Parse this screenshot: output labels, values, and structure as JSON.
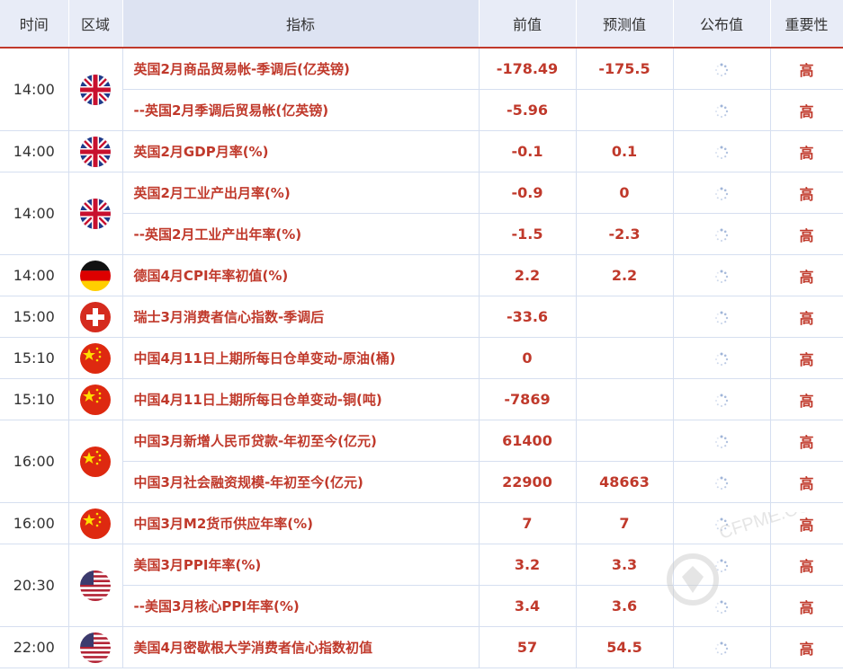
{
  "headers": {
    "time": "时间",
    "region": "区域",
    "indicator": "指标",
    "prev": "前值",
    "forecast": "预测值",
    "actual": "公布值",
    "importance": "重要性"
  },
  "groups": [
    {
      "time": "14:00",
      "flag": "uk",
      "rows": [
        {
          "name": "英国2月商品贸易帐-季调后(亿英镑)",
          "prev": "-178.49",
          "forecast": "-175.5",
          "importance": "高"
        },
        {
          "name": "--英国2月季调后贸易帐(亿英镑)",
          "prev": "-5.96",
          "forecast": "",
          "importance": "高"
        }
      ]
    },
    {
      "time": "14:00",
      "flag": "uk",
      "rows": [
        {
          "name": "英国2月GDP月率(%)",
          "prev": "-0.1",
          "forecast": "0.1",
          "importance": "高"
        }
      ]
    },
    {
      "time": "14:00",
      "flag": "uk",
      "rows": [
        {
          "name": "英国2月工业产出月率(%)",
          "prev": "-0.9",
          "forecast": "0",
          "importance": "高"
        },
        {
          "name": "--英国2月工业产出年率(%)",
          "prev": "-1.5",
          "forecast": "-2.3",
          "importance": "高"
        }
      ]
    },
    {
      "time": "14:00",
      "flag": "de",
      "rows": [
        {
          "name": "德国4月CPI年率初值(%)",
          "prev": "2.2",
          "forecast": "2.2",
          "importance": "高"
        }
      ]
    },
    {
      "time": "15:00",
      "flag": "ch",
      "rows": [
        {
          "name": "瑞士3月消费者信心指数-季调后",
          "prev": "-33.6",
          "forecast": "",
          "importance": "高"
        }
      ]
    },
    {
      "time": "15:10",
      "flag": "cn",
      "rows": [
        {
          "name": "中国4月11日上期所每日仓单变动-原油(桶)",
          "prev": "0",
          "forecast": "",
          "importance": "高"
        }
      ]
    },
    {
      "time": "15:10",
      "flag": "cn",
      "rows": [
        {
          "name": "中国4月11日上期所每日仓单变动-铜(吨)",
          "prev": "-7869",
          "forecast": "",
          "importance": "高"
        }
      ]
    },
    {
      "time": "16:00",
      "flag": "cn",
      "rows": [
        {
          "name": "中国3月新增人民币贷款-年初至今(亿元)",
          "prev": "61400",
          "forecast": "",
          "importance": "高"
        },
        {
          "name": "中国3月社会融资规模-年初至今(亿元)",
          "prev": "22900",
          "forecast": "48663",
          "importance": "高"
        }
      ]
    },
    {
      "time": "16:00",
      "flag": "cn",
      "rows": [
        {
          "name": "中国3月M2货币供应年率(%)",
          "prev": "7",
          "forecast": "7",
          "importance": "高"
        }
      ]
    },
    {
      "time": "20:30",
      "flag": "us",
      "rows": [
        {
          "name": "美国3月PPI年率(%)",
          "prev": "3.2",
          "forecast": "3.3",
          "importance": "高"
        },
        {
          "name": "--美国3月核心PPI年率(%)",
          "prev": "3.4",
          "forecast": "3.6",
          "importance": "高"
        }
      ]
    },
    {
      "time": "22:00",
      "flag": "us",
      "rows": [
        {
          "name": "美国4月密歇根大学消费者信心指数初值",
          "prev": "57",
          "forecast": "54.5",
          "importance": "高"
        }
      ]
    }
  ],
  "watermark": "CFPME.COM"
}
